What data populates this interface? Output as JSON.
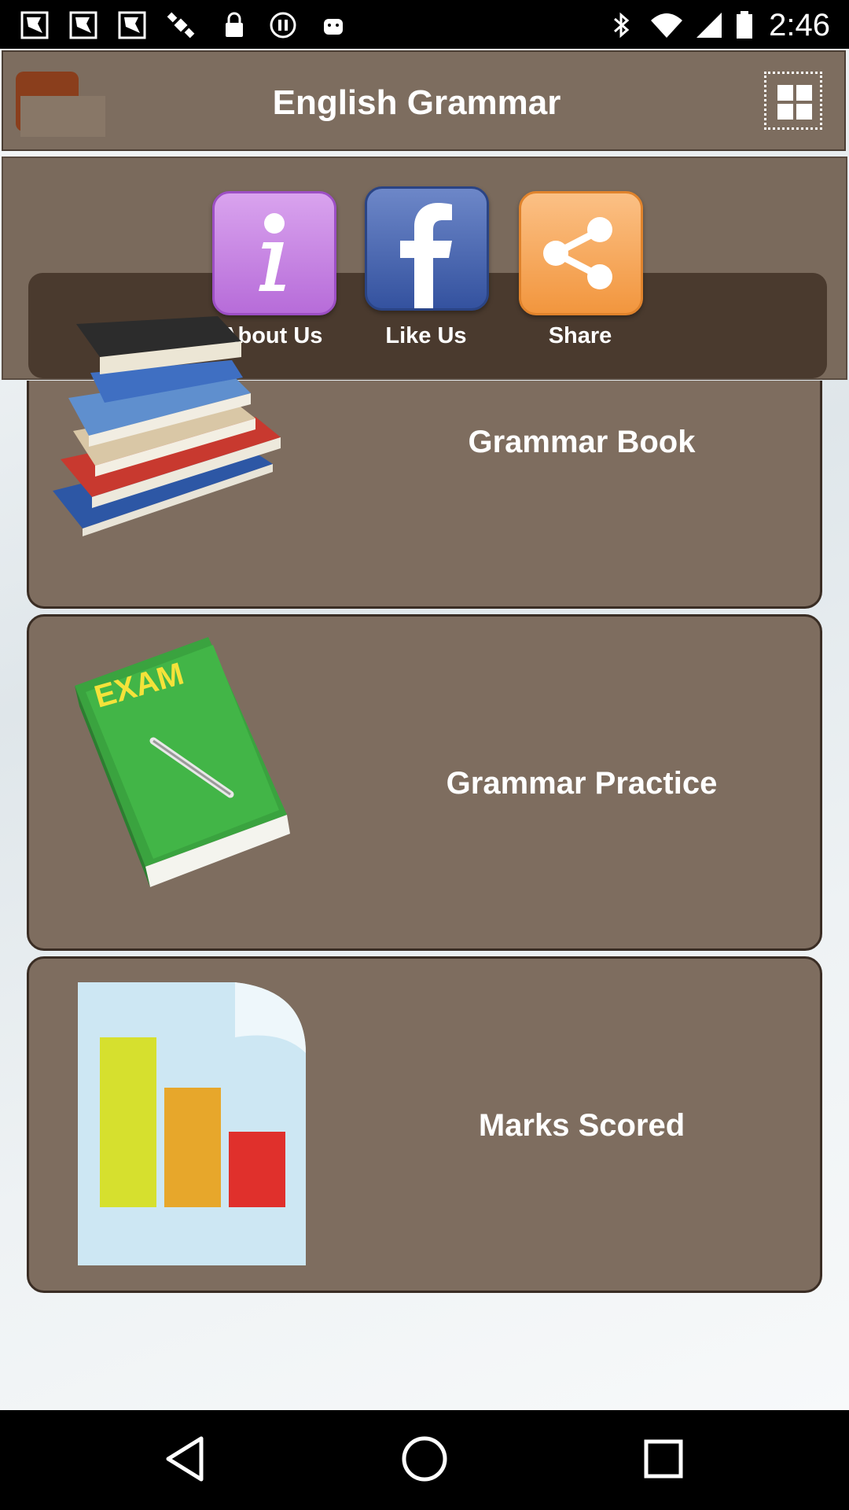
{
  "status_bar": {
    "time": "2:46",
    "left_icons": [
      "notification-icon",
      "notification-icon",
      "notification-icon",
      "gps-satellite-icon",
      "lock-icon",
      "data-saver-icon",
      "android-icon"
    ],
    "right_icons": [
      "bluetooth-icon",
      "wifi-icon",
      "signal-icon",
      "battery-icon"
    ]
  },
  "header": {
    "title": "English Grammar",
    "menu_icon": "grid-menu-icon"
  },
  "social": {
    "about_label": "About Us",
    "like_label": "Like Us",
    "share_label": "Share",
    "colors": {
      "about": "#b76cd9",
      "like": "#3b5aa8",
      "share": "#f6a253"
    }
  },
  "menu": {
    "items": [
      {
        "label": "Grammar Book",
        "icon": "books-stack-icon"
      },
      {
        "label": "Grammar Practice",
        "icon": "exam-book-icon",
        "image_text": "EXAM"
      },
      {
        "label": "Marks Scored",
        "icon": "bar-chart-icon"
      }
    ]
  },
  "nav": {
    "buttons": [
      "back-icon",
      "home-icon",
      "recents-icon"
    ]
  }
}
